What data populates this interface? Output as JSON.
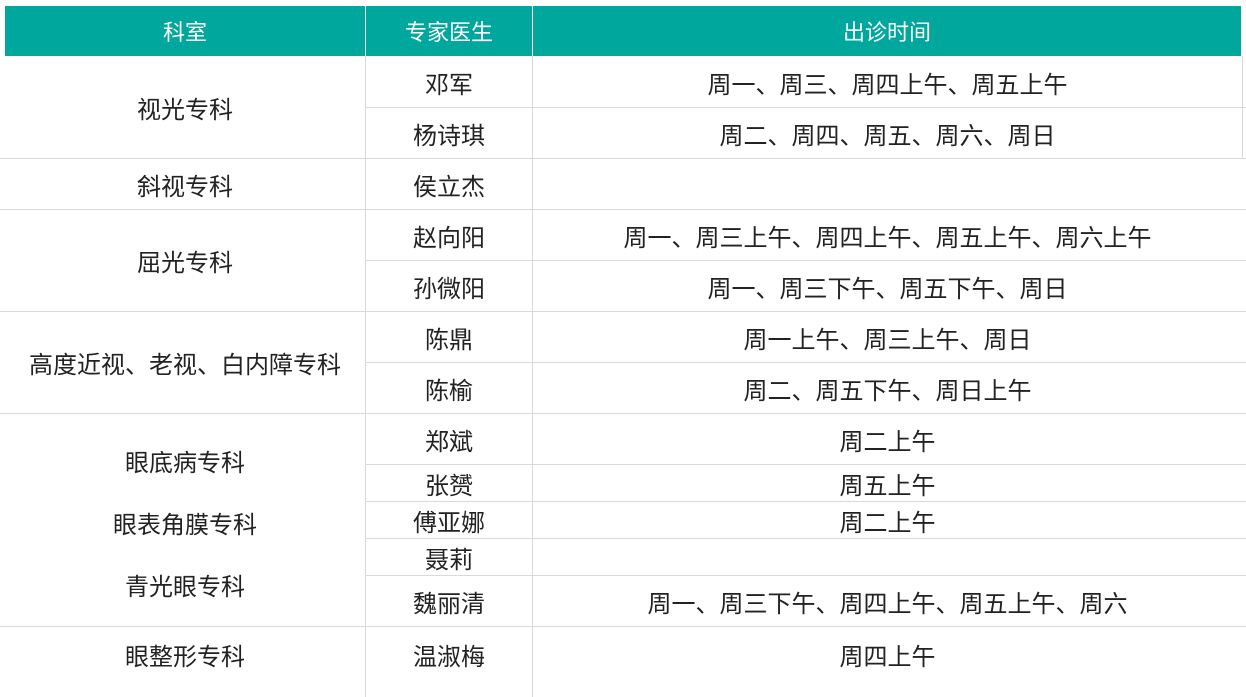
{
  "table": {
    "headers": {
      "dept": "科室",
      "doctor": "专家医生",
      "time": "出诊时间"
    },
    "departments": [
      "视光专科",
      "斜视专科",
      "屈光专科",
      "高度近视、老视、白内障专科",
      "眼底病专科",
      "眼表角膜专科",
      "青光眼专科",
      "眼整形专科"
    ],
    "rows": [
      {
        "doctor": "邓军",
        "time": "周一、周三、周四上午、周五上午"
      },
      {
        "doctor": "杨诗琪",
        "time": "周二、周四、周五、周六、周日"
      },
      {
        "doctor": "侯立杰",
        "time": ""
      },
      {
        "doctor": "赵向阳",
        "time": "周一、周三上午、周四上午、周五上午、周六上午"
      },
      {
        "doctor": "孙微阳",
        "time": "周一、周三下午、周五下午、周日"
      },
      {
        "doctor": "陈鼎",
        "time": "周一上午、周三上午、周日"
      },
      {
        "doctor": "陈榆",
        "time": "周二、周五下午、周日上午"
      },
      {
        "doctor": "郑斌",
        "time": "周二上午"
      },
      {
        "doctor": "张赟",
        "time": "周五上午"
      },
      {
        "doctor": "傅亚娜",
        "time": "周二上午"
      },
      {
        "doctor": "聂莉",
        "time": ""
      },
      {
        "doctor": "魏丽清",
        "time": "周一、周三下午、周四上午、周五上午、周六"
      },
      {
        "doctor": "温淑梅",
        "time": "周四上午"
      }
    ]
  },
  "colors": {
    "header_bg": "#00a79d",
    "header_text": "#ffffff",
    "grid": "#d9d9d9"
  }
}
